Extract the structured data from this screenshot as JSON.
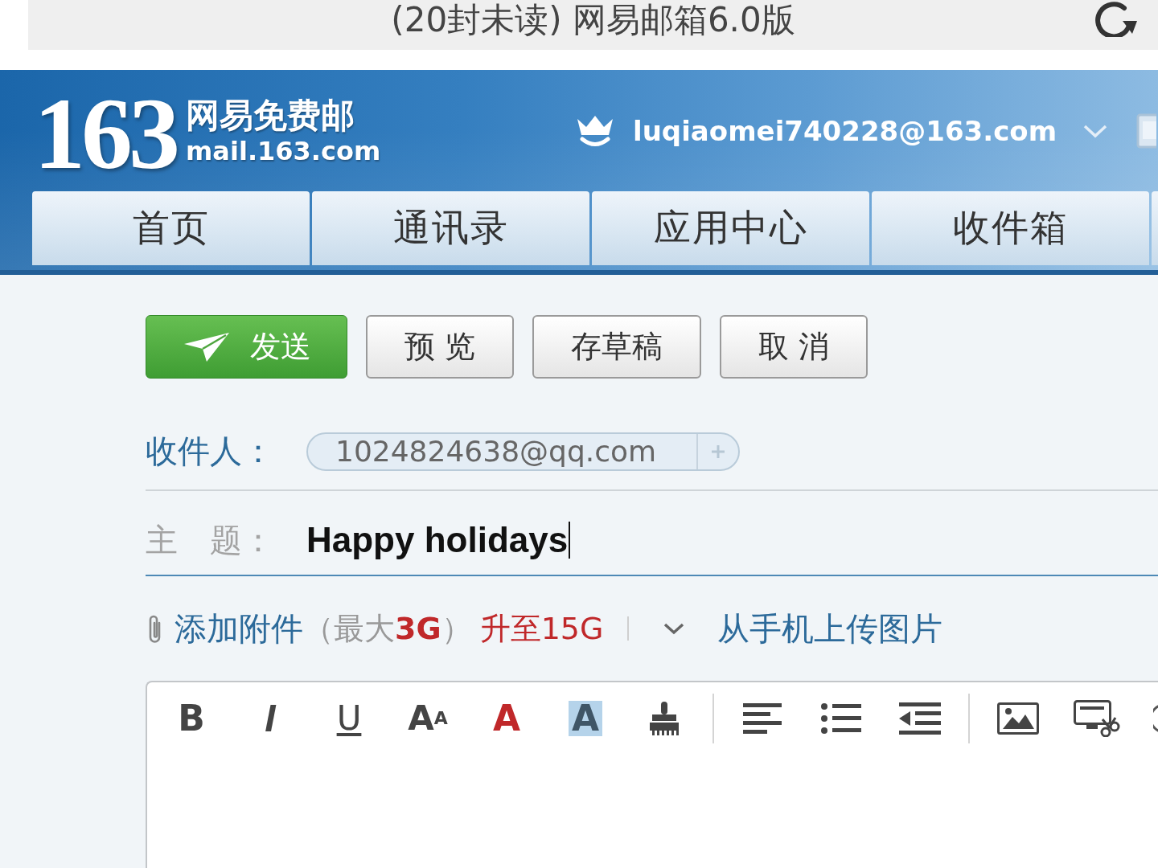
{
  "browser": {
    "title": "(20封未读) 网易邮箱6.0版"
  },
  "header": {
    "logo": {
      "number": "163",
      "name": "网易免费邮",
      "domain": "mail.163.com"
    },
    "account": "luqiaomei740228@163.com"
  },
  "nav_tabs": [
    {
      "label": "首页"
    },
    {
      "label": "通讯录"
    },
    {
      "label": "应用中心"
    },
    {
      "label": "收件箱"
    }
  ],
  "actions": [
    {
      "kind": "send",
      "label": "发送"
    },
    {
      "kind": "plain",
      "label": "预 览"
    },
    {
      "kind": "plain",
      "label": "存草稿"
    },
    {
      "kind": "plain",
      "label": "取 消"
    }
  ],
  "recipient": {
    "label": "收件人：",
    "addresses": [
      "1024824638@qq.com"
    ]
  },
  "subject": {
    "label": "主　题：",
    "value": "Happy holidays"
  },
  "attachment": {
    "add_link": "添加附件",
    "limit": "（最大**3G**）",
    "upgrade_link": "升至15G",
    "upload_link": "从手机上传图片"
  },
  "editor": {
    "toolbar": [
      [
        {
          "kind": "bold",
          "label": "B"
        },
        {
          "kind": "italic",
          "label": "I"
        },
        {
          "kind": "underline",
          "label": "U"
        },
        {
          "kind": "font-size",
          "label": "A$^{A}$"
        },
        {
          "kind": "font-color",
          "label": "A"
        },
        {
          "kind": "highlight",
          "label": "A"
        },
        {
          "kind": "brush"
        }
      ],
      [
        {
          "kind": "align-left"
        },
        {
          "kind": "bullet-list"
        },
        {
          "kind": "outdent"
        }
      ],
      [
        {
          "kind": "image"
        },
        {
          "kind": "screenshot"
        },
        {
          "kind": "circle"
        }
      ]
    ]
  }
}
